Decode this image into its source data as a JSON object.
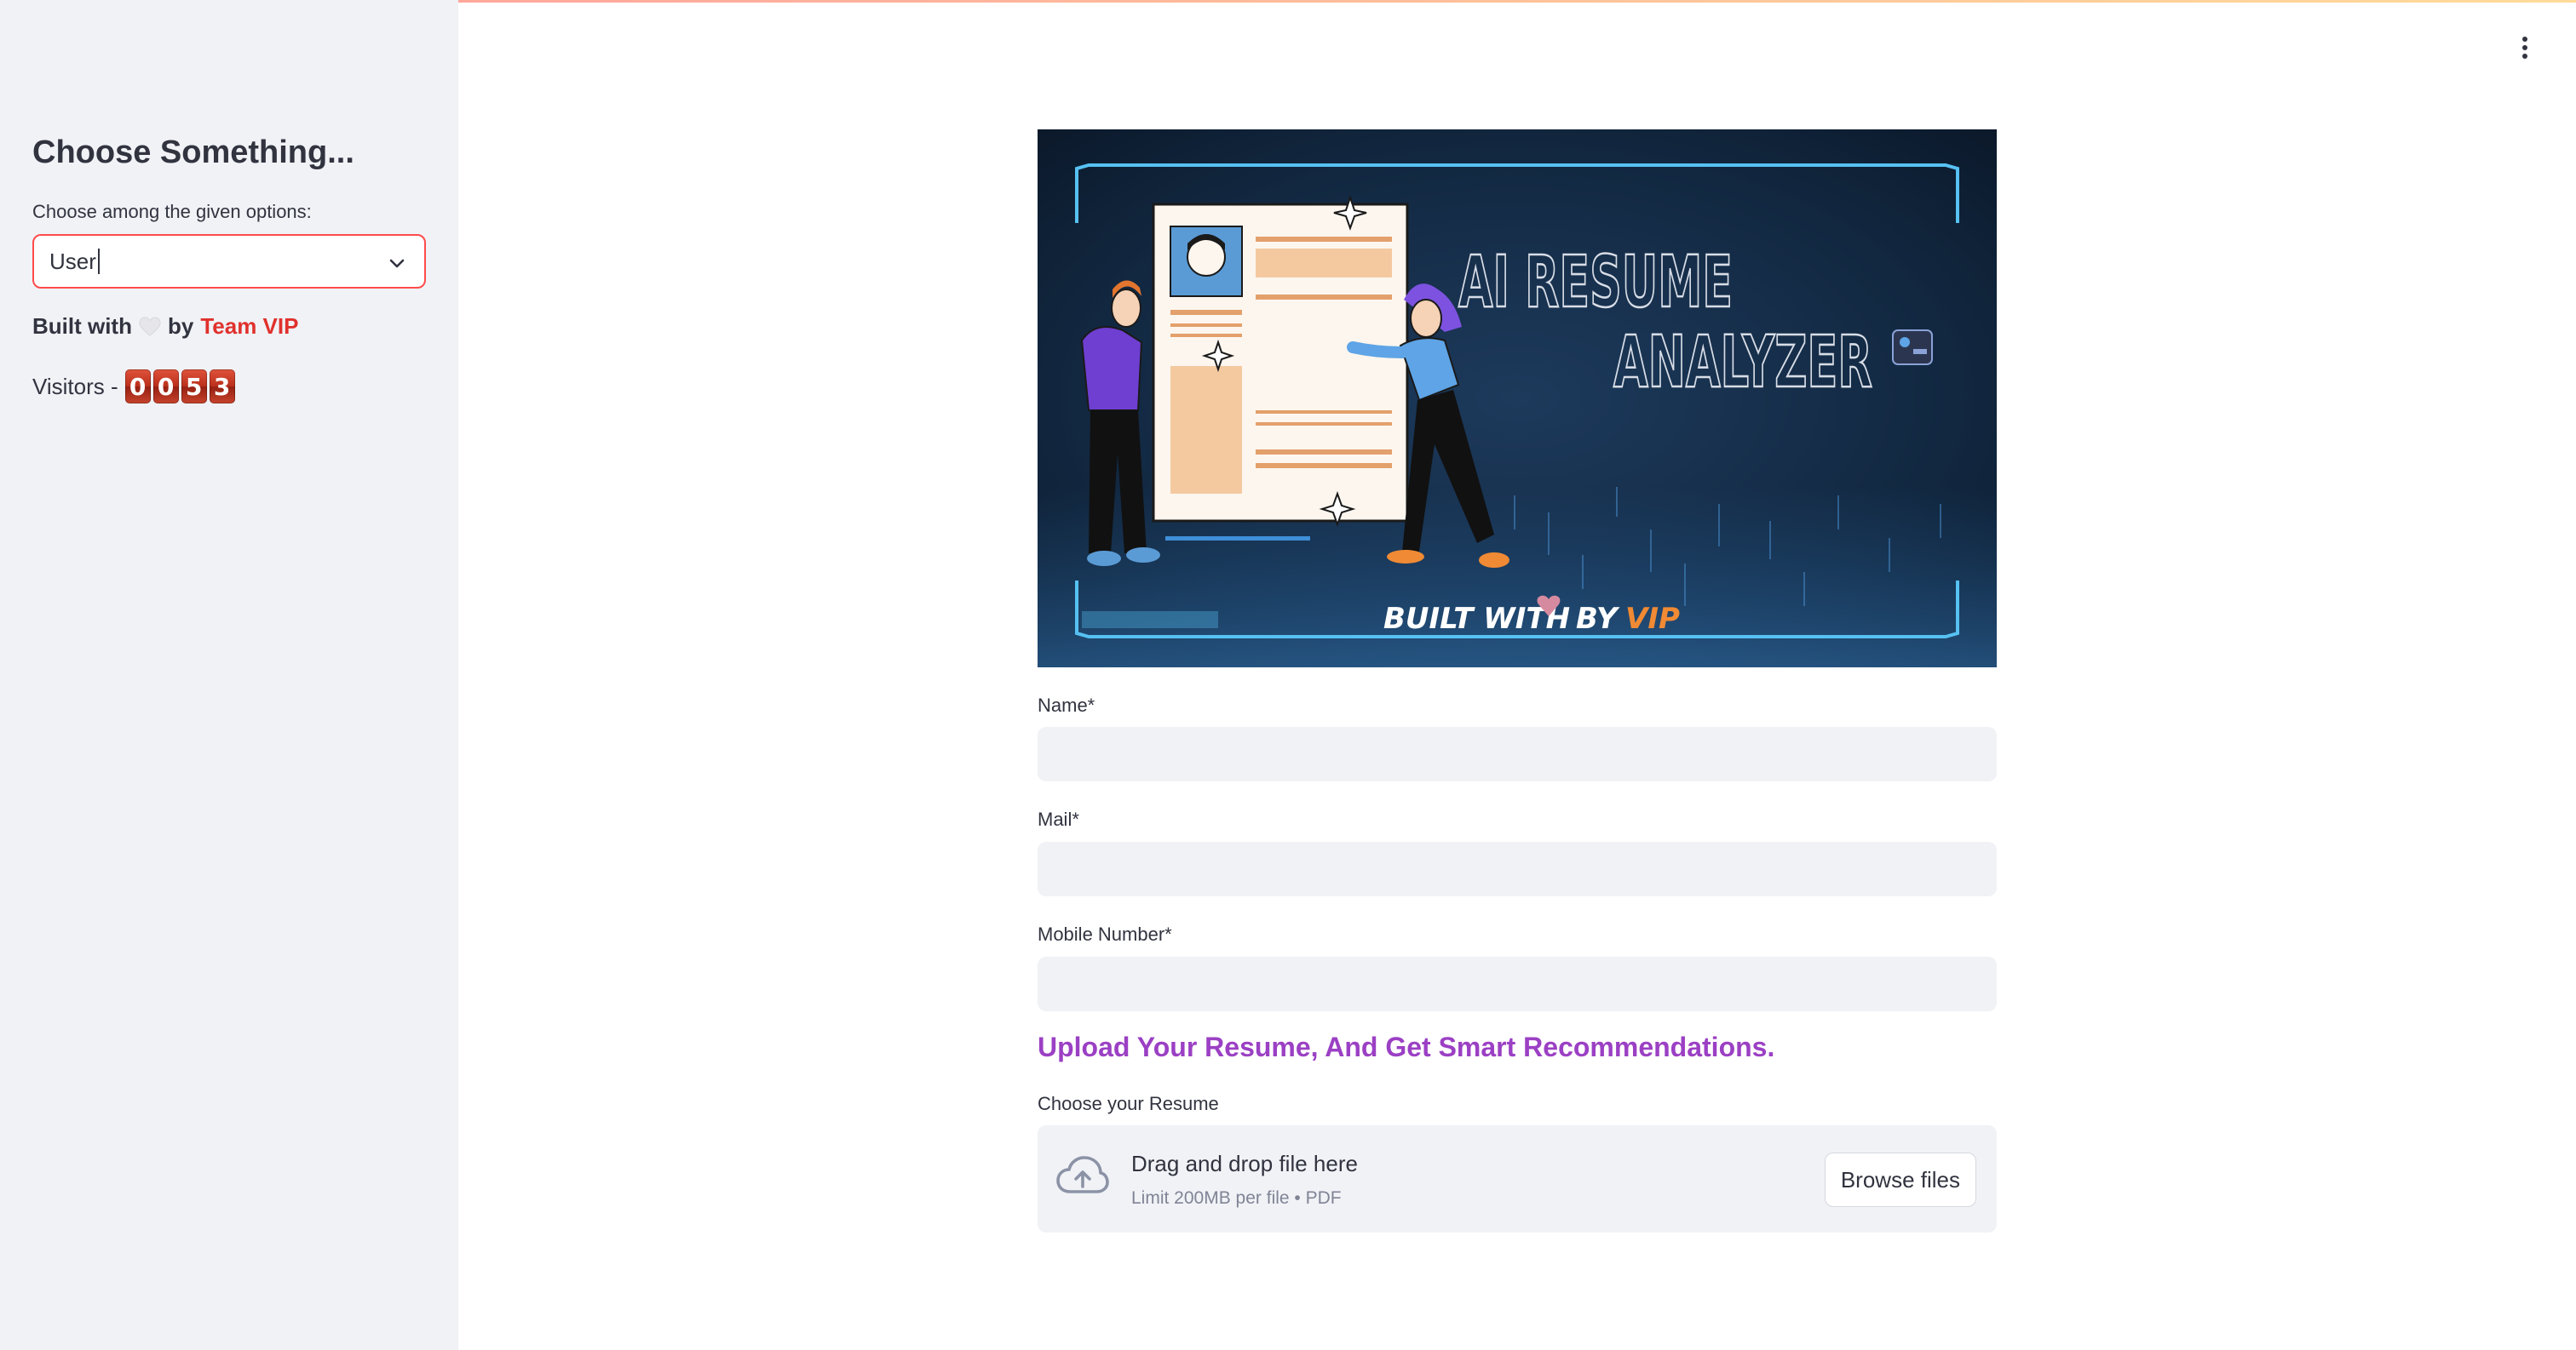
{
  "sidebar": {
    "title": "Choose Something...",
    "select_label": "Choose among the given options:",
    "select_value": "User",
    "built_prefix": "Built with",
    "built_by": "by",
    "team_name": "Team VIP",
    "visitors_label": "Visitors -",
    "visitor_digits": [
      "0",
      "0",
      "5",
      "3"
    ]
  },
  "banner": {
    "title_line1": "AI RESUME",
    "title_line2": "ANALYZER",
    "footer_built": "BUILT WITH",
    "footer_by": "BY",
    "footer_vip": "VIP"
  },
  "form": {
    "name_label": "Name*",
    "mail_label": "Mail*",
    "mobile_label": "Mobile Number*",
    "name_value": "",
    "mail_value": "",
    "mobile_value": ""
  },
  "upload": {
    "heading": "Upload Your Resume, And Get Smart Recommendations.",
    "label": "Choose your Resume",
    "drag_text": "Drag and drop file here",
    "limit_text": "Limit 200MB per file • PDF",
    "browse_label": "Browse files"
  },
  "colors": {
    "accent_red": "#ff4b4b",
    "team_red": "#e0312c",
    "heading_purple": "#9b40c4",
    "sidebar_bg": "#f0f2f6",
    "input_bg": "#f0f2f6"
  },
  "icons": {
    "select_chevron": "chevron-down-icon",
    "menu": "kebab-menu-icon",
    "upload": "cloud-upload-icon",
    "heart": "heart-icon"
  }
}
